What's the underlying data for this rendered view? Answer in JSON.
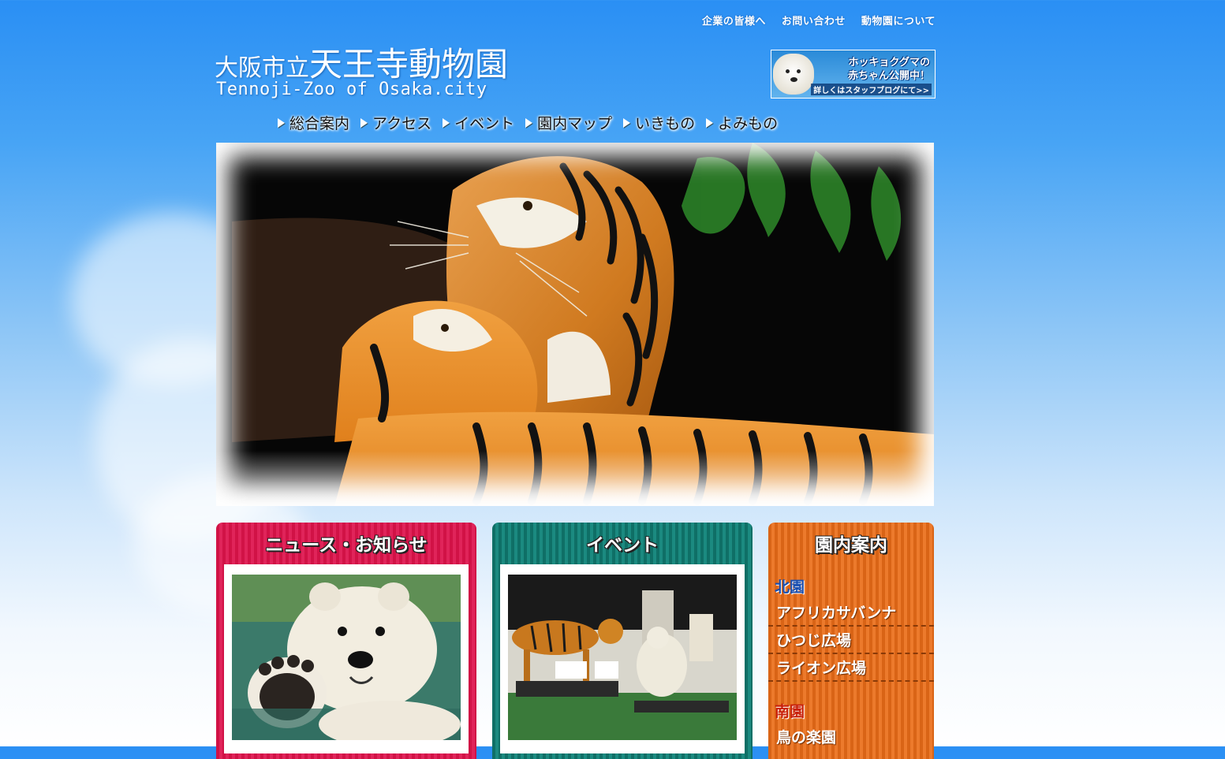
{
  "top_links": [
    "企業の皆様へ",
    "お問い合わせ",
    "動物園について"
  ],
  "logo": {
    "prefix": "大阪市立",
    "name": "天王寺動物園",
    "english": "Tennoji-Zoo of Osaka.city"
  },
  "banner": {
    "line1": "ホッキョクグマの",
    "line2": "赤ちゃん公開中！",
    "line3": "詳しくはスタッフブログにて>>"
  },
  "global_nav": [
    "総合案内",
    "アクセス",
    "イベント",
    "園内マップ",
    "いきもの",
    "よみもの"
  ],
  "panels": {
    "news": {
      "title": "ニュース・お知らせ",
      "color": "#d11246"
    },
    "event": {
      "title": "イベント",
      "color": "#0f6f66"
    },
    "map": {
      "title": "園内案内",
      "color": "#d96416",
      "north_label": "北園",
      "north_items": [
        "アフリカサバンナ",
        "ひつじ広場",
        "ライオン広場"
      ],
      "south_label": "南園",
      "south_items": [
        "鳥の楽園"
      ]
    }
  }
}
